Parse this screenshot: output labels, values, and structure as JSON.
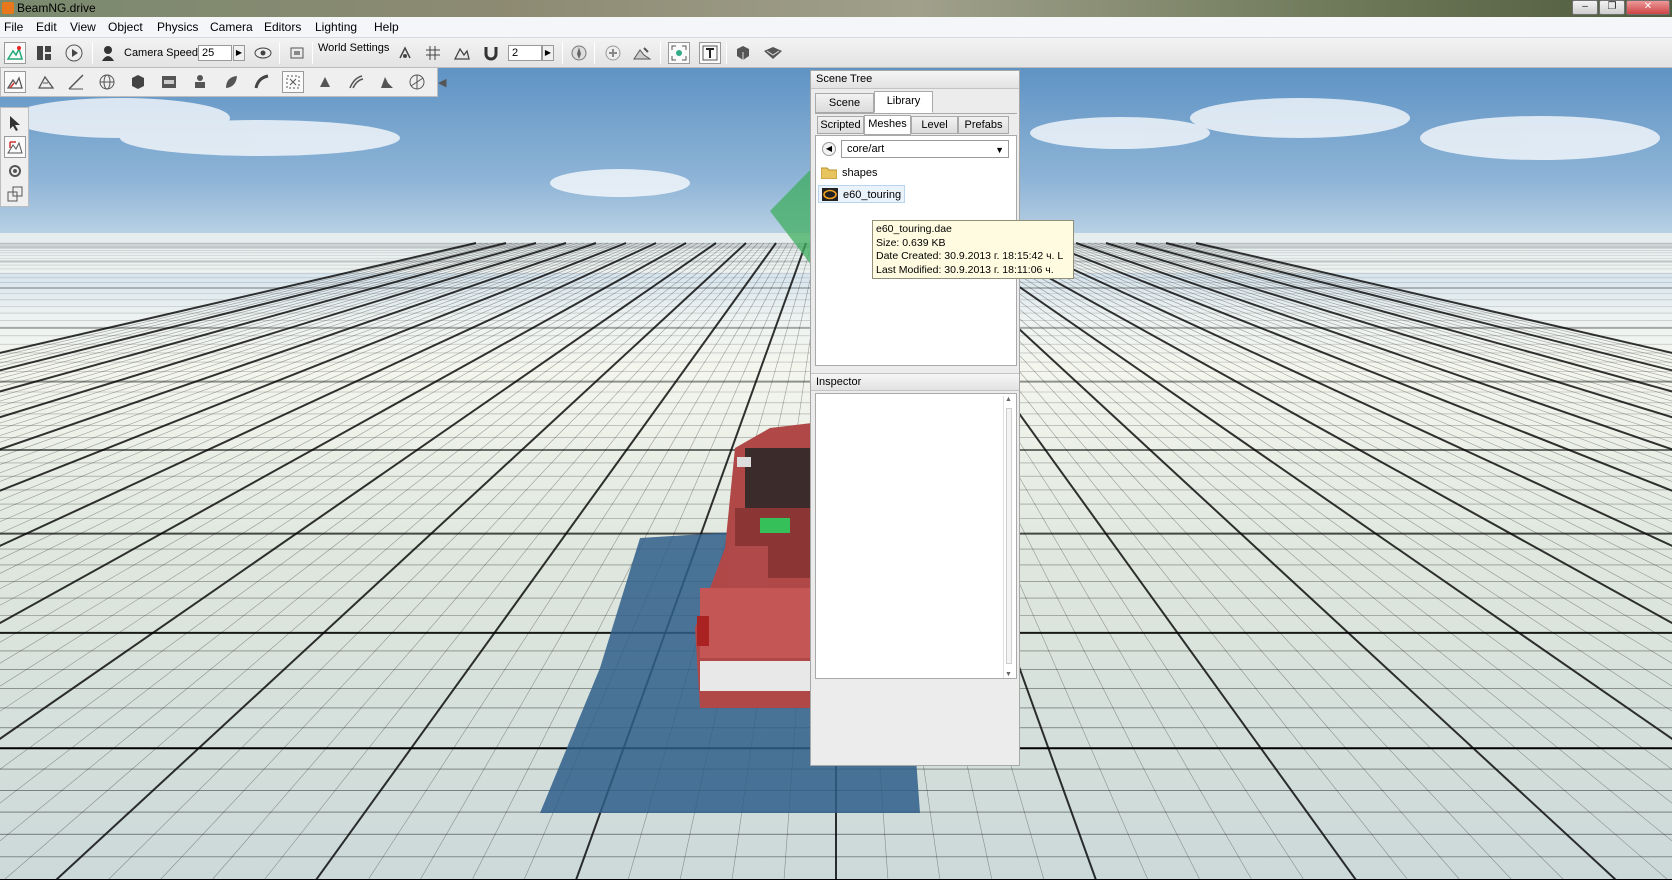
{
  "window": {
    "title": "BeamNG.drive",
    "controls": [
      "–",
      "❐",
      "✕"
    ]
  },
  "menu": [
    "File",
    "Edit",
    "View",
    "Object",
    "Physics",
    "Camera",
    "Editors",
    "Lighting",
    "Help"
  ],
  "toolbar": {
    "camera_speed_label": "Camera Speed",
    "camera_speed_value": "25",
    "world_settings_label": "World Settings",
    "snap_value": "2"
  },
  "scene_tree": {
    "title": "Scene Tree",
    "tabs": [
      {
        "label": "Scene",
        "active": false
      },
      {
        "label": "Library",
        "active": true
      }
    ],
    "subtabs": [
      {
        "label": "Scripted",
        "active": false
      },
      {
        "label": "Meshes",
        "active": true
      },
      {
        "label": "Level",
        "active": false
      },
      {
        "label": "Prefabs",
        "active": false
      }
    ],
    "path": "core/art",
    "items": [
      {
        "name": "shapes",
        "icon": "folder-icon",
        "selected": false
      },
      {
        "name": "e60_touring",
        "icon": "mesh-file-icon",
        "selected": true
      }
    ]
  },
  "tooltip": {
    "filename": "e60_touring.dae",
    "size": "Size: 0.639 KB",
    "created": "Date Created: 30.9.2013 г.   18:15:42 ч. L",
    "modified": "Last Modified: 30.9.2013 г.   18:11:06 ч."
  },
  "inspector": {
    "title": "Inspector"
  },
  "colors": {
    "sky_top": "#5f93c4",
    "ground": "#dfe7de",
    "grid_line": "#000000",
    "truck_body": "#b64a4a",
    "gizmo": "#3fae5f"
  }
}
